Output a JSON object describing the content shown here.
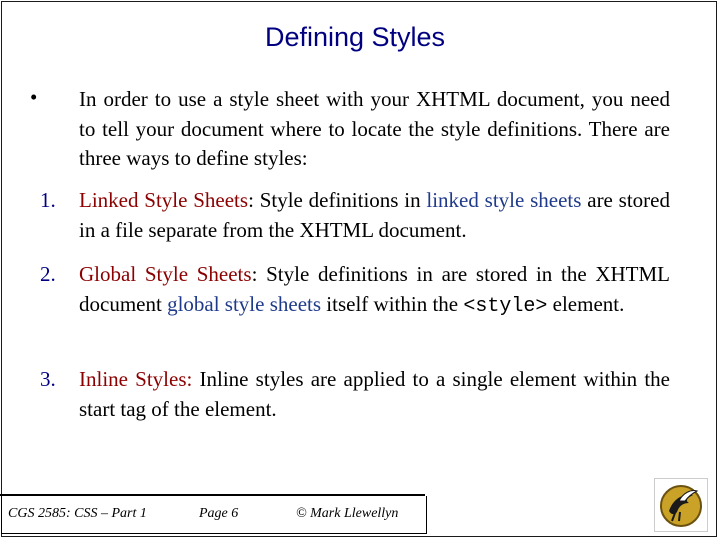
{
  "slide": {
    "title": "Defining Styles",
    "bullet": "•",
    "intro": "In order to use a style sheet with your XHTML document, you need to tell your document where to locate the style definitions.  There are three ways to define styles:",
    "items": [
      {
        "num": "1.",
        "term": "Linked Style Sheets",
        "colon": ":",
        "part1": " Style definitions in ",
        "highlight": "linked style sheets",
        "part2": " are stored in a file separate from the XHTML document."
      },
      {
        "num": "2.",
        "term": "Global Style Sheets",
        "colon": ":",
        "part1": "  Style definitions in are stored in the XHTML document ",
        "highlight": "global style sheets",
        "part2": " itself within the ",
        "code": "<style>",
        "part3": " element."
      },
      {
        "num": "3.",
        "term": "Inline Styles:",
        "part1": " Inline styles are applied to a single element within the start tag of the element."
      }
    ]
  },
  "footer": {
    "course": "CGS 2585: CSS – Part 1",
    "page": "Page 6",
    "author": "© Mark Llewellyn"
  },
  "logo": {
    "icon": "pegasus-logo-icon",
    "color": "#c9a227"
  }
}
